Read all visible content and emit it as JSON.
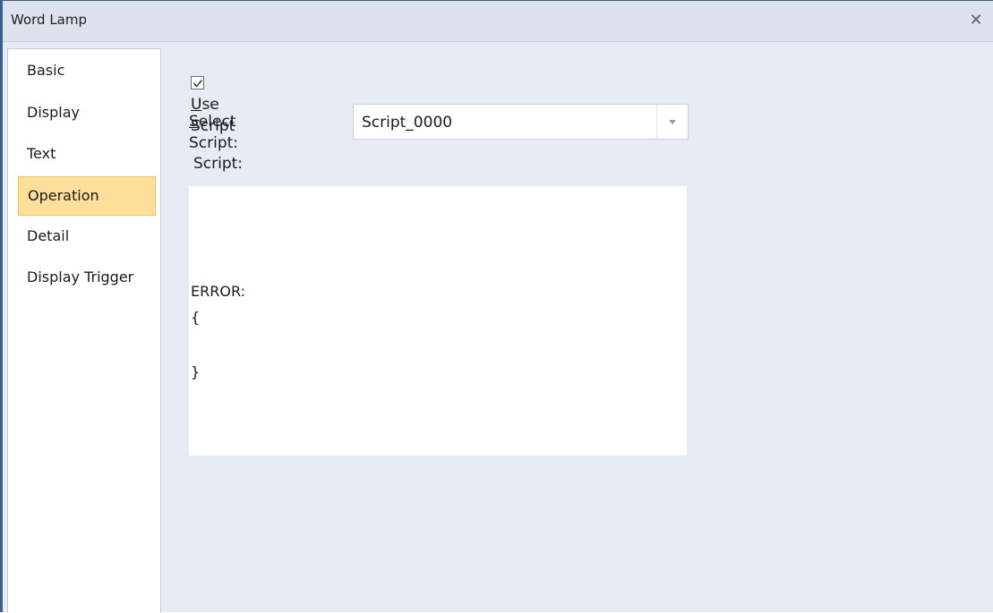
{
  "window": {
    "title": "Word Lamp",
    "close_icon": "close-icon"
  },
  "sidebar": {
    "items": [
      {
        "label": "Basic",
        "active": false
      },
      {
        "label": "Display",
        "active": false
      },
      {
        "label": "Text",
        "active": false
      },
      {
        "label": "Operation",
        "active": true
      },
      {
        "label": "Detail",
        "active": false
      },
      {
        "label": "Display Trigger",
        "active": false
      }
    ],
    "active_color": "#fddf9b"
  },
  "operation": {
    "use_script": {
      "checked": true,
      "accel": "U",
      "rest": "se Script"
    },
    "select_script": {
      "accel": "S",
      "rest": "elect Script:",
      "value": "Script_0000"
    },
    "script_label": "Script:",
    "script_lines": [
      "ERROR:",
      "{",
      "",
      "}"
    ]
  }
}
